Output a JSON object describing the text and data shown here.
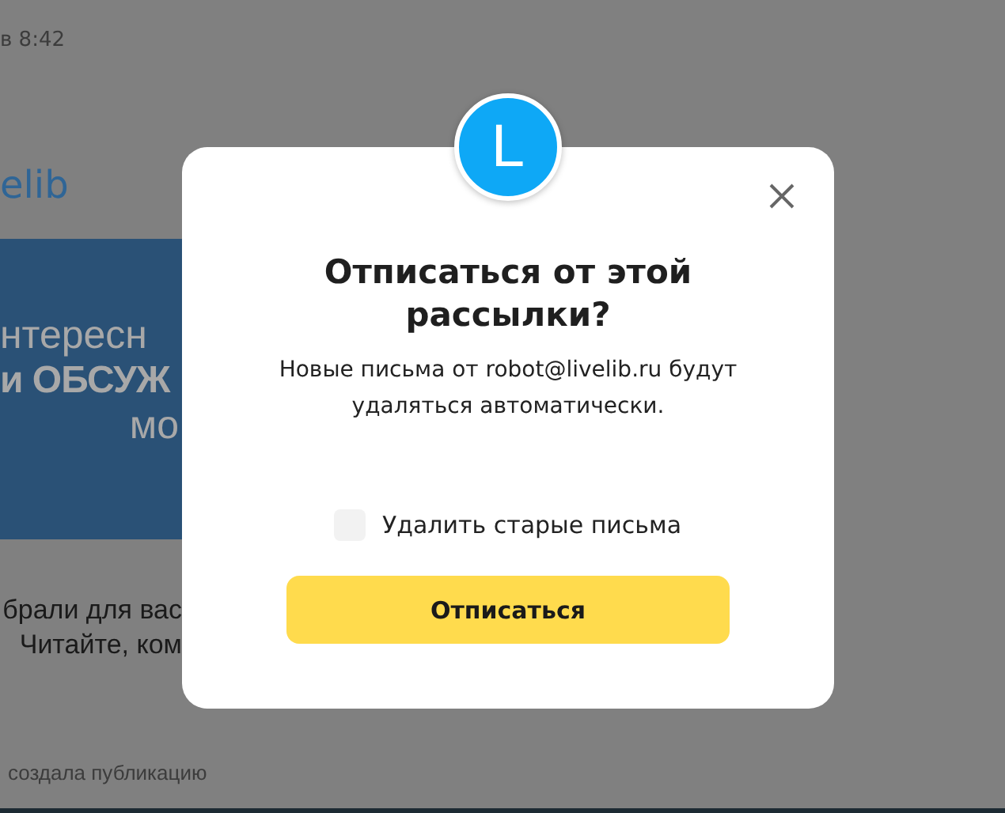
{
  "background_page": {
    "timestamp": "в 8:42",
    "logo": "elib",
    "banner_lines": [
      "нтересн",
      "и ОБСУЖ",
      "мо"
    ],
    "intro_lines": [
      "брали для вас",
      "Читайте, ком"
    ],
    "activity": "создала публикацию"
  },
  "dialog": {
    "avatar_letter": "L",
    "title": "Отписаться от этой рассылки?",
    "message": "Новые письма от robot@livelib.ru будут удаляться автоматически.",
    "checkbox": {
      "label": "Удалить старые письма",
      "checked": false
    },
    "button": "Отписаться"
  }
}
